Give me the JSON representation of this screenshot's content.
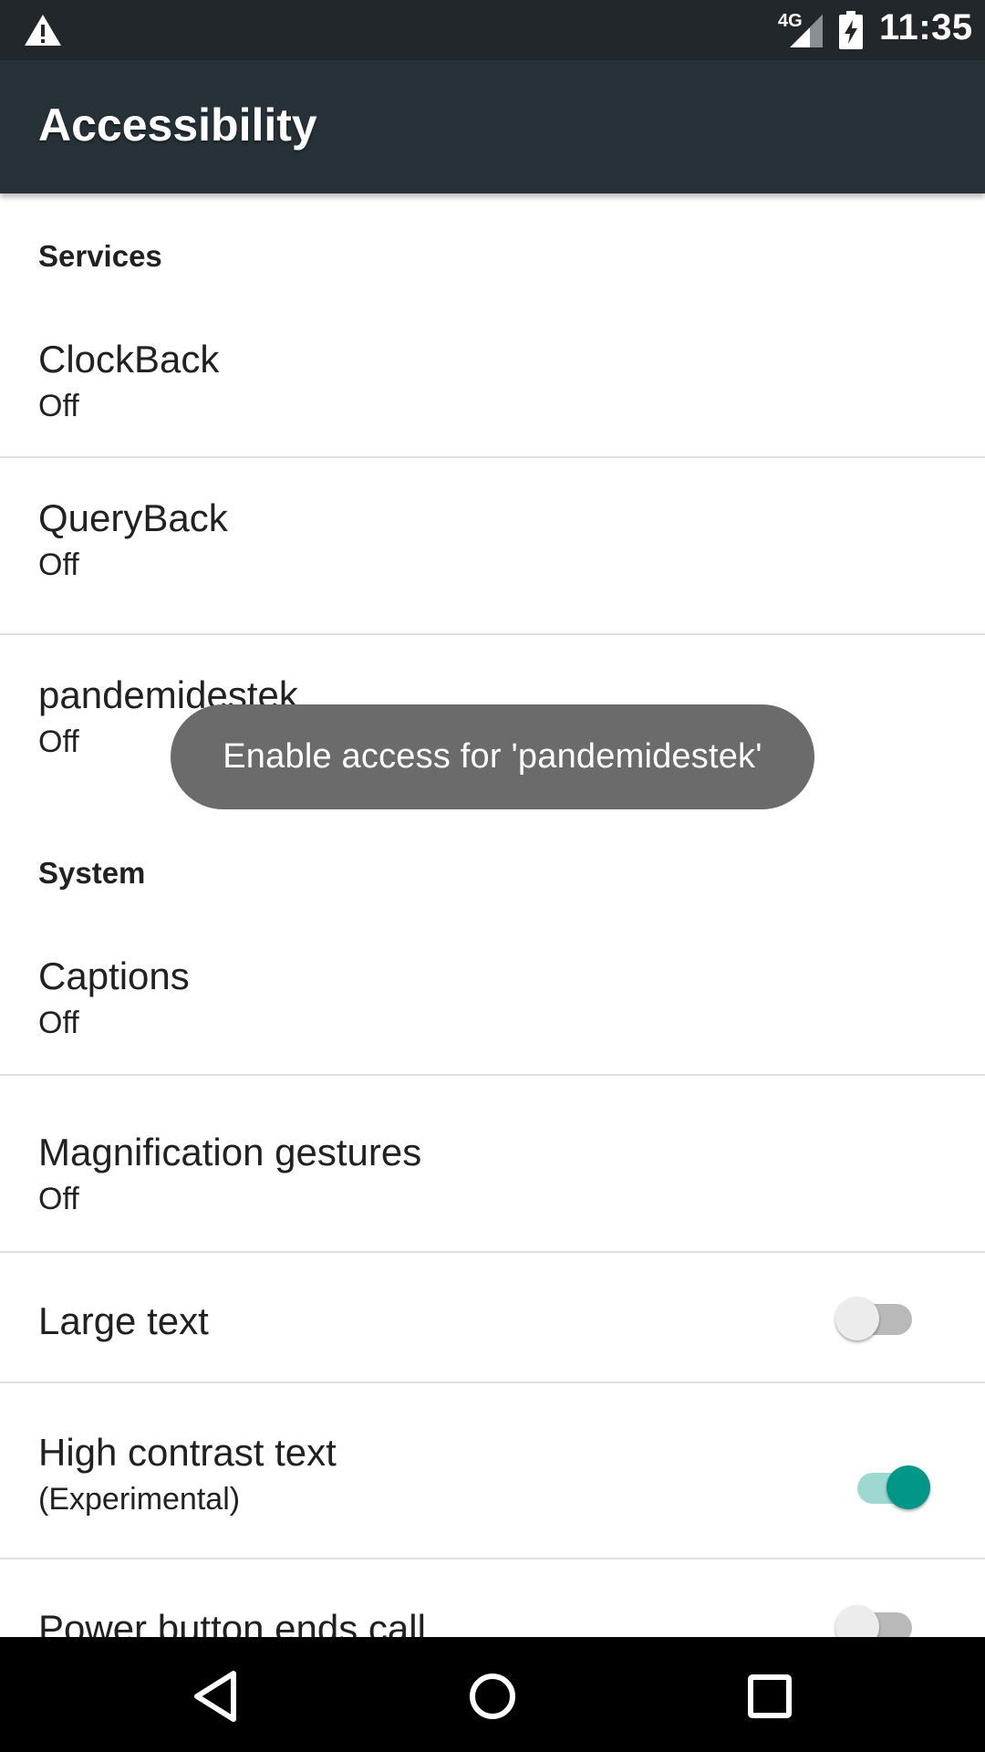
{
  "status_bar": {
    "network": "4G",
    "time": "11:35",
    "icons": [
      "warning-icon",
      "signal-icon",
      "battery-charging-icon"
    ]
  },
  "app_bar": {
    "title": "Accessibility"
  },
  "sections": {
    "services": {
      "header": "Services",
      "items": [
        {
          "title": "ClockBack",
          "summary": "Off"
        },
        {
          "title": "QueryBack",
          "summary": "Off"
        },
        {
          "title": "pandemidestek",
          "summary": "Off"
        }
      ]
    },
    "system": {
      "header": "System",
      "items": [
        {
          "title": "Captions",
          "summary": "Off"
        },
        {
          "title": "Magnification gestures",
          "summary": "Off"
        },
        {
          "title": "Large text",
          "switch": "off"
        },
        {
          "title": "High contrast text",
          "summary": "(Experimental)",
          "switch": "on"
        },
        {
          "title": "Power button ends call",
          "switch": "off"
        }
      ]
    }
  },
  "toast": {
    "message": "Enable access for 'pandemidestek'"
  },
  "colors": {
    "status_bar": "#21272b",
    "app_bar": "#263238",
    "accent": "#009688",
    "toast": "#6b6b6b"
  },
  "nav_bar": {
    "icons": [
      "back-icon",
      "home-icon",
      "recents-icon"
    ]
  }
}
